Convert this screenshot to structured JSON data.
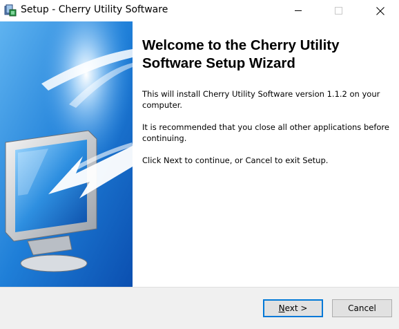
{
  "window": {
    "title": "Setup - Cherry Utility Software",
    "icon": "installer-icon",
    "controls": {
      "minimize": "minimize-icon",
      "maximize": "maximize-icon",
      "close": "close-icon",
      "close_glyph": "✕"
    }
  },
  "wizard": {
    "heading": "Welcome to the Cherry Utility Software Setup Wizard",
    "paragraphs": [
      "This will install Cherry Utility Software version 1.1.2 on your computer.",
      "It is recommended that you close all other applications before continuing.",
      "Click Next to continue, or Cancel to exit Setup."
    ]
  },
  "buttons": {
    "next_mnemonic": "N",
    "next_rest": "ext >",
    "cancel": "Cancel"
  },
  "colors": {
    "banner_blue": "#1a6fd0",
    "focus_border": "#0078d7",
    "footer_bg": "#f0f0f0"
  }
}
